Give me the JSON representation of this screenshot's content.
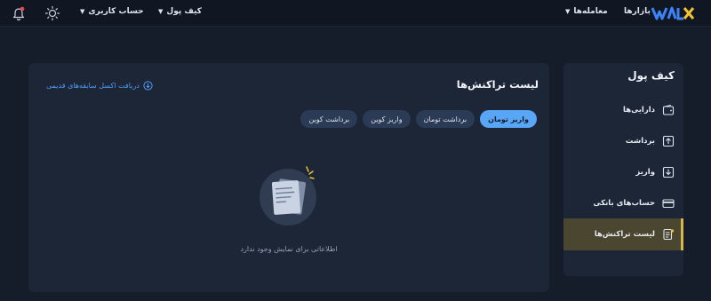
{
  "header": {
    "logo_text": "WALLEX",
    "nav": {
      "markets": "بازارها",
      "trades": "معامله‌ها",
      "wallet": "کیف پول",
      "account": "حساب کاربری"
    },
    "icons": [
      "logo-icon",
      "sun-icon",
      "bell-icon",
      "chevron-down-icon"
    ],
    "colors": {
      "background": "#101722",
      "logo_blue": "#3b82f6",
      "logo_yellow": "#f2c232"
    }
  },
  "sidebar": {
    "title": "کیف پول",
    "items": [
      {
        "label": "دارایی‌ها",
        "icon": "wallet-icon"
      },
      {
        "label": "برداشت",
        "icon": "upload-icon"
      },
      {
        "label": "واریز",
        "icon": "download-icon"
      },
      {
        "label": "حساب‌های بانکی",
        "icon": "card-icon"
      },
      {
        "label": "لیست تراکنش‌ها",
        "icon": "list-icon",
        "active": true
      }
    ],
    "colors": {
      "active_bg": "#4a4630",
      "active_accent": "#d8b648"
    }
  },
  "main": {
    "title": "لیست تراکنش‌ها",
    "excel_link": "دریافت اکسل سابقه‌های قدیمی",
    "tabs": [
      {
        "label": "واریز تومان",
        "active": true
      },
      {
        "label": "برداشت تومان"
      },
      {
        "label": "واریز کوین"
      },
      {
        "label": "برداشت کوین"
      }
    ],
    "empty_text": "اطلاعاتی برای نمایش وجود ندارد",
    "empty_icon": "empty-document-icon",
    "colors": {
      "accent": "#5aa6f6",
      "link": "#4f9cf5"
    }
  }
}
